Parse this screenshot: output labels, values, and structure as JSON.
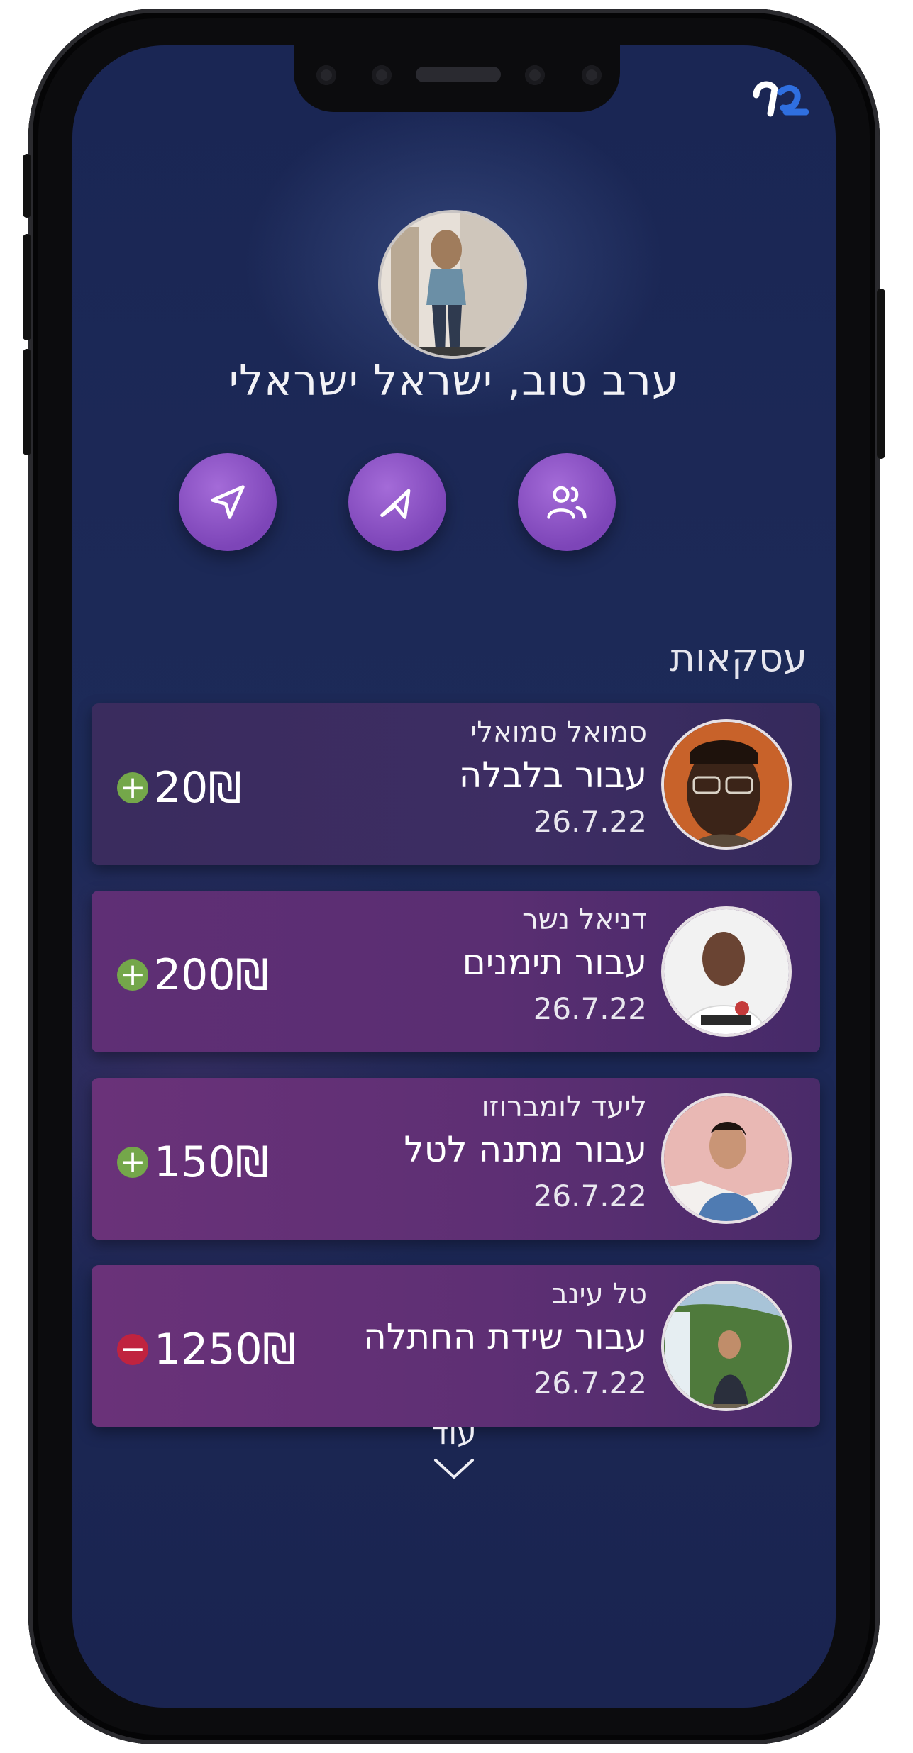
{
  "greeting": "ערב טוב, ישראל ישראלי",
  "actions": [
    {
      "name": "send-icon"
    },
    {
      "name": "navigate-icon"
    },
    {
      "name": "contacts-icon"
    }
  ],
  "section_title": "עסקאות",
  "transactions": [
    {
      "name": "סמואל סמואלי",
      "purpose": "עבור בלבלה",
      "date": "26.7.22",
      "amount": "20",
      "currency": "₪",
      "direction": "plus"
    },
    {
      "name": "דניאל נשר",
      "purpose": "עבור תימנים",
      "date": "26.7.22",
      "amount": "200",
      "currency": "₪",
      "direction": "plus"
    },
    {
      "name": "ליעד לומברוזו",
      "purpose": "עבור מתנה לטל",
      "date": "26.7.22",
      "amount": "150",
      "currency": "₪",
      "direction": "plus"
    },
    {
      "name": "טל עינב",
      "purpose": "עבור שידת החתלה",
      "date": "26.7.22",
      "amount": "1250",
      "currency": "₪",
      "direction": "minus"
    }
  ],
  "more_label": "עוד",
  "colors": {
    "background": "#1b2755",
    "accent": "#8a52c4",
    "plus": "#74a74a",
    "minus": "#c0233f",
    "logo_blue": "#2f6fe0"
  }
}
